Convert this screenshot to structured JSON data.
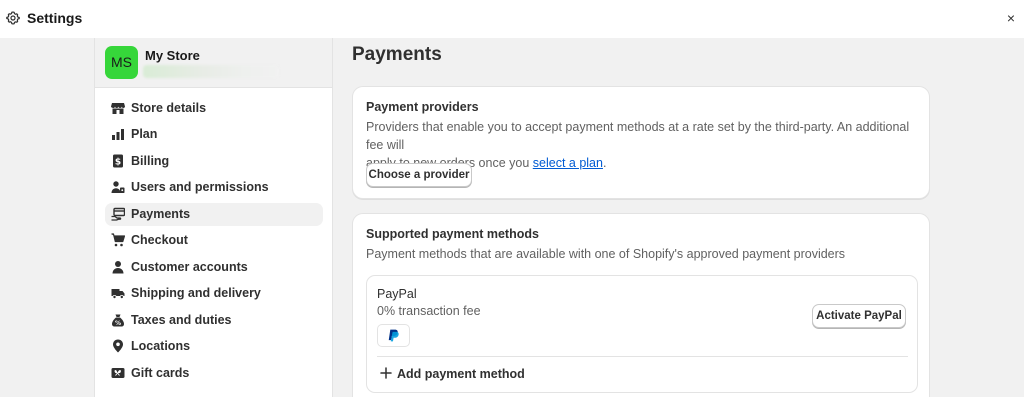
{
  "topbar": {
    "title": "Settings",
    "close_label": "×"
  },
  "store": {
    "avatar_initials": "MS",
    "name": "My Store"
  },
  "sidebar": {
    "items": [
      {
        "label": "Store details",
        "icon": "store-icon"
      },
      {
        "label": "Plan",
        "icon": "plan-icon"
      },
      {
        "label": "Billing",
        "icon": "billing-icon"
      },
      {
        "label": "Users and permissions",
        "icon": "users-icon"
      },
      {
        "label": "Payments",
        "icon": "payments-icon",
        "active": true
      },
      {
        "label": "Checkout",
        "icon": "cart-icon"
      },
      {
        "label": "Customer accounts",
        "icon": "person-icon"
      },
      {
        "label": "Shipping and delivery",
        "icon": "truck-icon"
      },
      {
        "label": "Taxes and duties",
        "icon": "tax-icon"
      },
      {
        "label": "Locations",
        "icon": "location-pin-icon"
      },
      {
        "label": "Gift cards",
        "icon": "gift-card-icon"
      }
    ]
  },
  "main": {
    "title": "Payments",
    "providers_card": {
      "title": "Payment providers",
      "desc_line1": "Providers that enable you to accept payment methods at a rate set by the third-party. An additional fee will",
      "desc_line2_prefix": "apply to new orders once you ",
      "desc_link": "select a plan",
      "desc_line2_suffix": ".",
      "button": "Choose a provider"
    },
    "methods_card": {
      "title": "Supported payment methods",
      "desc": "Payment methods that are available with one of Shopify's approved payment providers",
      "method": {
        "name": "PayPal",
        "fee": "0% transaction fee",
        "button": "Activate PayPal",
        "logo_icon": "paypal-logo-icon"
      },
      "add_label": "Add payment method"
    }
  },
  "colors": {
    "accent_link": "#005bd3",
    "avatar_bg": "#36d63a",
    "page_bg": "#f1f1f1"
  }
}
